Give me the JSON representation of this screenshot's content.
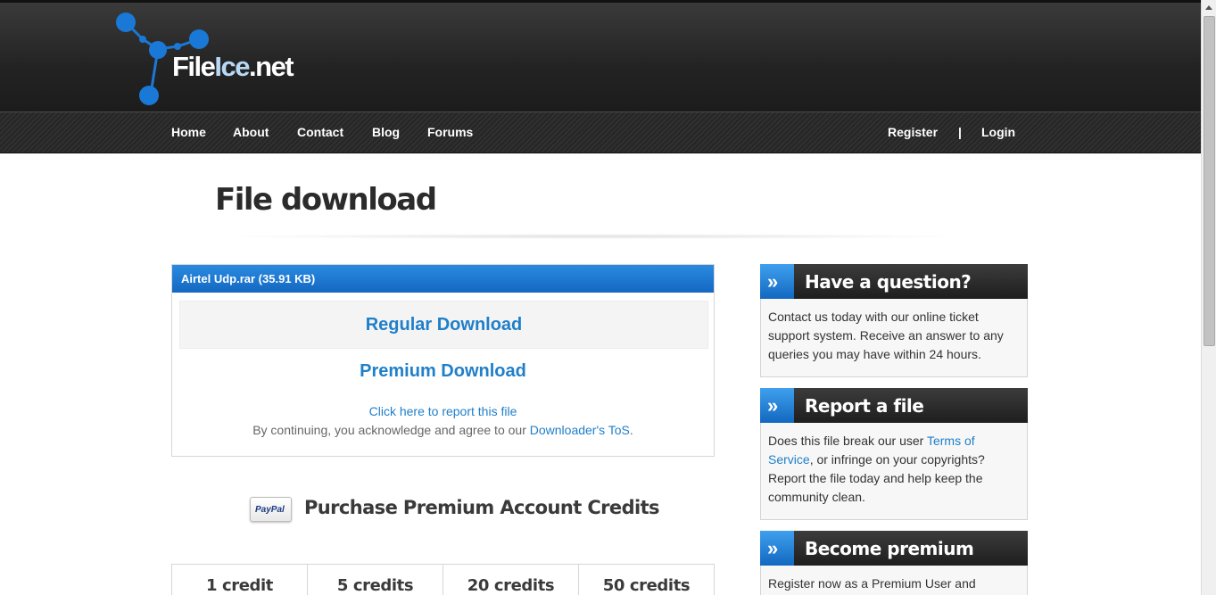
{
  "site": {
    "logo_part1": "File",
    "logo_part2": "Ice",
    "logo_part3": ".net"
  },
  "nav": {
    "home": "Home",
    "about": "About",
    "contact": "Contact",
    "blog": "Blog",
    "forums": "Forums",
    "register": "Register",
    "separator": "|",
    "login": "Login"
  },
  "page": {
    "title": "File download"
  },
  "download": {
    "file_header": "Airtel Udp.rar (35.91 KB)",
    "regular_label": "Regular Download",
    "premium_label": "Premium Download",
    "report_link": "Click here to report this file",
    "tos_prefix": "By continuing, you acknowledge and agree to our ",
    "tos_link": "Downloader's ToS",
    "tos_suffix": "."
  },
  "purchase": {
    "paypal_badge": "PayPal",
    "title": "Purchase Premium Account Credits",
    "credits": [
      "1 credit",
      "5 credits",
      "20 credits",
      "50 credits"
    ]
  },
  "sidebar": {
    "question": {
      "title": "Have a question?",
      "body": "Contact us today with our online ticket support system. Receive an answer to any queries you may have within 24 hours."
    },
    "report": {
      "title": "Report a file",
      "body_1": "Does this file break our user ",
      "terms_link": "Terms of Service",
      "body_2": ", or infringe on your copyrights? Report the file today and help keep the community clean."
    },
    "premium": {
      "title": "Become premium",
      "body": "Register now as a Premium User and"
    },
    "icon_glyph": "»"
  },
  "colors": {
    "accent_blue": "#1f7fc9",
    "header_dark": "#232323",
    "panel_header_blue": "#1a74d0"
  }
}
